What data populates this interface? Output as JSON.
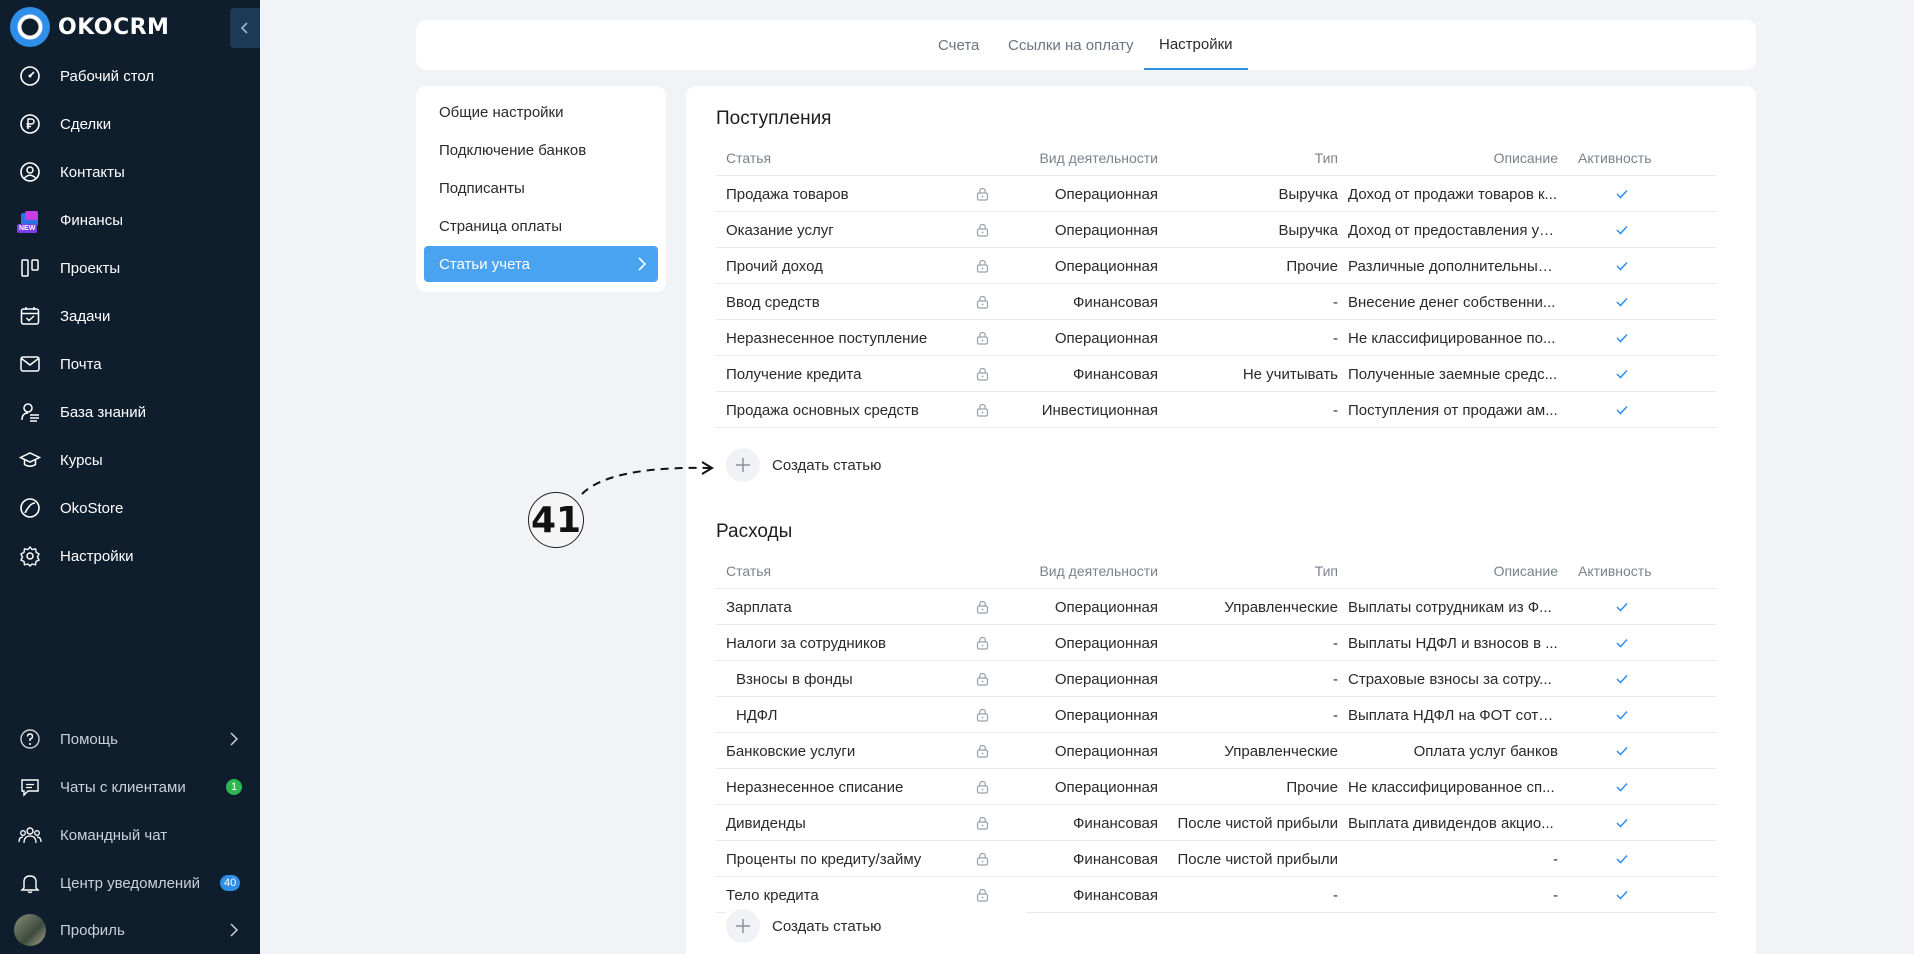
{
  "app": {
    "logo_text": "OKOCRM",
    "nav": [
      {
        "label": "Рабочий стол",
        "icon": "dashboard-icon"
      },
      {
        "label": "Сделки",
        "icon": "ruble-icon"
      },
      {
        "label": "Контакты",
        "icon": "contact-icon"
      },
      {
        "label": "Финансы",
        "icon": "finance-icon",
        "tag": "NEW"
      },
      {
        "label": "Проекты",
        "icon": "projects-icon"
      },
      {
        "label": "Задачи",
        "icon": "calendar-check-icon"
      },
      {
        "label": "Почта",
        "icon": "mail-icon"
      },
      {
        "label": "База знаний",
        "icon": "knowledge-icon"
      },
      {
        "label": "Курсы",
        "icon": "graduation-cap-icon"
      },
      {
        "label": "OkoStore",
        "icon": "store-icon"
      },
      {
        "label": "Настройки",
        "icon": "gear-icon"
      }
    ],
    "bottom_nav": [
      {
        "label": "Помощь",
        "icon": "help-icon"
      },
      {
        "label": "Чаты с клиентами",
        "icon": "chat-icon",
        "badge": "1",
        "badge_color": "#2bb84f"
      },
      {
        "label": "Командный чат",
        "icon": "team-icon"
      },
      {
        "label": "Центр уведомлений",
        "icon": "bell-icon",
        "badge": "40",
        "badge_color": "#2f8ee8"
      },
      {
        "label": "Профиль",
        "icon": "avatar"
      }
    ]
  },
  "tabs": [
    "Счета",
    "Ссылки на оплату",
    "Настройки"
  ],
  "active_tab": "Настройки",
  "settings_menu": [
    "Общие настройки",
    "Подключение банков",
    "Подписанты",
    "Страница оплаты",
    "Статьи учета"
  ],
  "active_menu": "Статьи учета",
  "columns": {
    "name": "Статья",
    "activity": "Вид деятельности",
    "type": "Тип",
    "description": "Описание",
    "active": "Активность"
  },
  "income": {
    "title": "Поступления",
    "rows": [
      {
        "name": "Продажа товаров",
        "activity": "Операционная",
        "type": "Выручка",
        "description": "Доход от продажи товаров к..."
      },
      {
        "name": "Оказание услуг",
        "activity": "Операционная",
        "type": "Выручка",
        "description": "Доход от предоставления ус..."
      },
      {
        "name": "Прочий доход",
        "activity": "Операционная",
        "type": "Прочие",
        "description": "Различные дополнительные..."
      },
      {
        "name": "Ввод средств",
        "activity": "Финансовая",
        "type": "-",
        "description": "Внесение денег собственни..."
      },
      {
        "name": "Неразнесенное поступление",
        "activity": "Операционная",
        "type": "-",
        "description": "Не классифицированное по..."
      },
      {
        "name": "Получение кредита",
        "activity": "Финансовая",
        "type": "Не учитывать",
        "description": "Полученные заемные средс..."
      },
      {
        "name": "Продажа основных средств",
        "activity": "Инвестиционная",
        "type": "-",
        "description": "Поступления от продажи ам..."
      }
    ],
    "create_label": "Создать статью"
  },
  "expenses": {
    "title": "Расходы",
    "rows": [
      {
        "name": "Зарплата",
        "activity": "Операционная",
        "type": "Управленческие",
        "description": "Выплаты сотрудникам из Ф..."
      },
      {
        "name": "Налоги за сотрудников",
        "activity": "Операционная",
        "type": "-",
        "description": "Выплаты НДФЛ и взносов в ..."
      },
      {
        "name": "Взносы в фонды",
        "activity": "Операционная",
        "type": "-",
        "description": "Страховые взносы за сотру...",
        "sub": true
      },
      {
        "name": "НДФЛ",
        "activity": "Операционная",
        "type": "-",
        "description": "Выплата НДФЛ на ФОТ сотр...",
        "sub": true
      },
      {
        "name": "Банковские услуги",
        "activity": "Операционная",
        "type": "Управленческие",
        "description": "Оплата услуг банков",
        "align_right": true
      },
      {
        "name": "Неразнесенное списание",
        "activity": "Операционная",
        "type": "Прочие",
        "description": "Не классифицированное сп..."
      },
      {
        "name": "Дивиденды",
        "activity": "Финансовая",
        "type": "После чистой прибыли",
        "description": "Выплата дивидендов акцио..."
      },
      {
        "name": "Проценты по кредиту/займу",
        "activity": "Финансовая",
        "type": "После чистой прибыли",
        "description": "-",
        "align_right": true
      },
      {
        "name": "Тело кредита",
        "activity": "Финансовая",
        "type": "-",
        "description": "-",
        "align_right": true
      }
    ],
    "create_label": "Создать статью"
  },
  "annotation": "41",
  "colors": {
    "sidebar": "#0f1e2d",
    "accent": "#2f8ee8",
    "active_menu": "#4aa3f0",
    "check": "#2f8ee8"
  }
}
